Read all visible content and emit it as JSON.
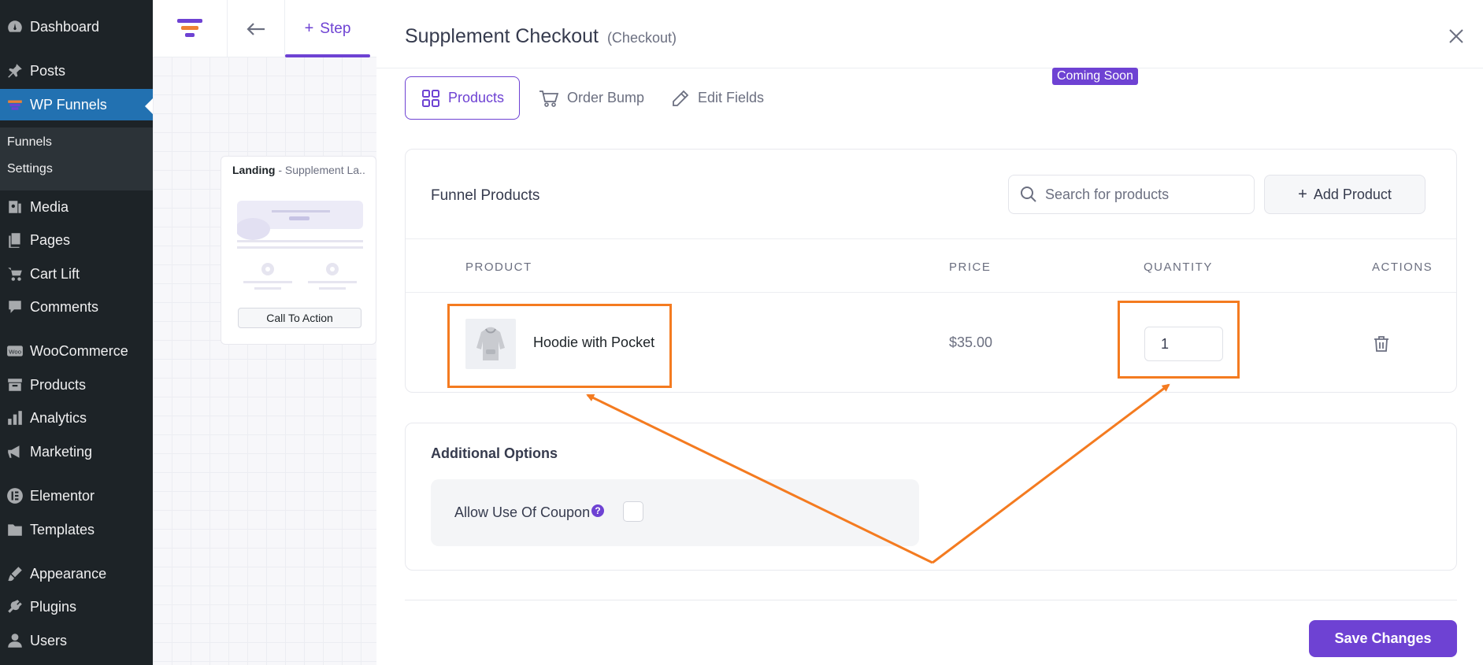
{
  "wp_menu": {
    "items": [
      {
        "label": "Dashboard",
        "icon": "dashboard-icon"
      },
      {
        "label": "Posts",
        "icon": "pin-icon"
      },
      {
        "label": "WP Funnels",
        "icon": "funnel-icon"
      },
      {
        "label": "Media",
        "icon": "media-icon"
      },
      {
        "label": "Pages",
        "icon": "pages-icon"
      },
      {
        "label": "Cart Lift",
        "icon": "cart-icon"
      },
      {
        "label": "Comments",
        "icon": "comment-icon"
      },
      {
        "label": "WooCommerce",
        "icon": "woo-icon"
      },
      {
        "label": "Products",
        "icon": "archive-icon"
      },
      {
        "label": "Analytics",
        "icon": "chart-icon"
      },
      {
        "label": "Marketing",
        "icon": "megaphone-icon"
      },
      {
        "label": "Elementor",
        "icon": "elementor-icon"
      },
      {
        "label": "Templates",
        "icon": "folder-icon"
      },
      {
        "label": "Appearance",
        "icon": "brush-icon"
      },
      {
        "label": "Plugins",
        "icon": "plug-icon"
      },
      {
        "label": "Users",
        "icon": "user-icon"
      }
    ],
    "submenu": [
      "Funnels",
      "Settings"
    ]
  },
  "canvas": {
    "step_label": "Step",
    "landing_title": "Landing",
    "landing_subtitle": "- Supplement La...",
    "cta_label": "Call To Action"
  },
  "modal": {
    "title": "Supplement Checkout",
    "subtitle": "(Checkout)",
    "tabs": [
      {
        "label": "Products",
        "icon": "grid-icon"
      },
      {
        "label": "Order Bump",
        "icon": "cart-icon"
      },
      {
        "label": "Edit Fields",
        "icon": "pencil-icon"
      }
    ],
    "coming_soon_badge": "Coming Soon",
    "products_panel": {
      "heading": "Funnel Products",
      "search_placeholder": "Search for products",
      "add_button": "Add Product",
      "columns": [
        "PRODUCT",
        "PRICE",
        "QUANTITY",
        "ACTIONS"
      ],
      "rows": [
        {
          "name": "Hoodie with Pocket",
          "price": "$35.00",
          "quantity": "1"
        }
      ]
    },
    "options_panel": {
      "heading": "Additional Options",
      "coupon_label": "Allow Use Of Coupon",
      "coupon_checked": false
    },
    "save_button": "Save Changes"
  },
  "colors": {
    "accent": "#6e42d3",
    "wp_sidebar": "#1d2327",
    "wp_active": "#2271b1",
    "annotation": "#f47b20"
  }
}
